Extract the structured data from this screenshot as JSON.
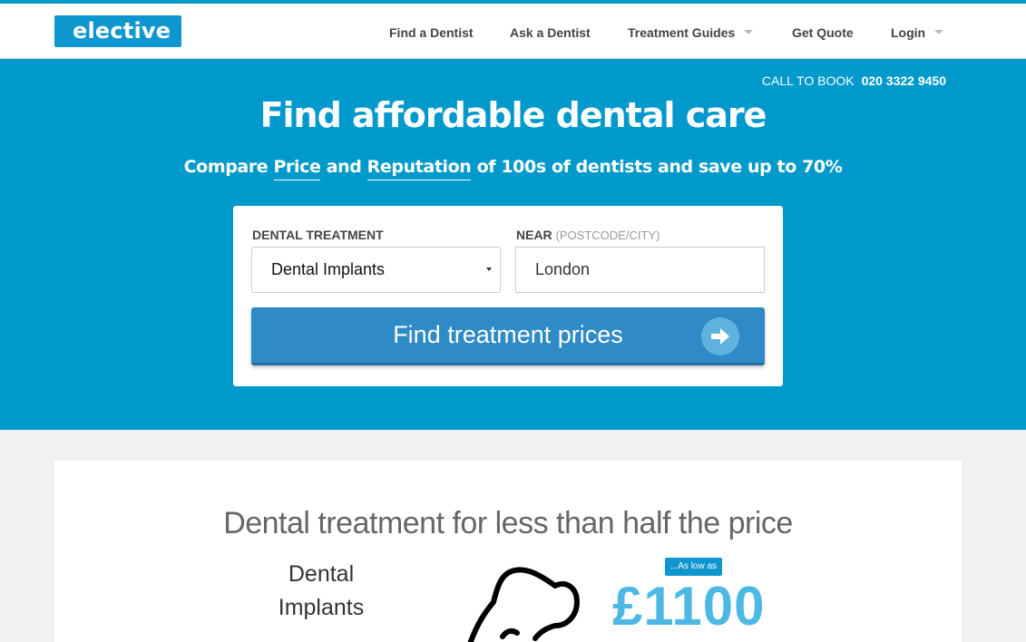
{
  "header": {
    "logo": "elective",
    "logo_mark": "*",
    "nav": [
      {
        "label": "Find a Dentist",
        "dropdown": false
      },
      {
        "label": "Ask a Dentist",
        "dropdown": false
      },
      {
        "label": "Treatment Guides",
        "dropdown": true
      },
      {
        "label": "Get Quote",
        "dropdown": false
      },
      {
        "label": "Login",
        "dropdown": true
      }
    ]
  },
  "hero": {
    "call_label": "CALL TO BOOK",
    "call_number": "020 3322 9450",
    "title": "Find affordable dental care",
    "sub_1": "Compare ",
    "sub_price": "Price",
    "sub_2": " and ",
    "sub_reputation": "Reputation",
    "sub_3": " of 100s of dentists and save up to 70%"
  },
  "search": {
    "treatment_label": "DENTAL TREATMENT",
    "treatment_value": "Dental Implants",
    "near_label": "NEAR",
    "near_hint": "(POSTCODE/CITY)",
    "near_value": "London",
    "button_label": "Find treatment prices",
    "button_icon": "arrow-right-icon"
  },
  "promo": {
    "title": "Dental treatment for less than half the price",
    "treatment_line1": "Dental",
    "treatment_line2": "Implants",
    "badge": "...As low as",
    "price": "£1100"
  },
  "colors": {
    "brand": "#0099cc",
    "button": "#2e8bc5",
    "price": "#4cb8e3"
  }
}
